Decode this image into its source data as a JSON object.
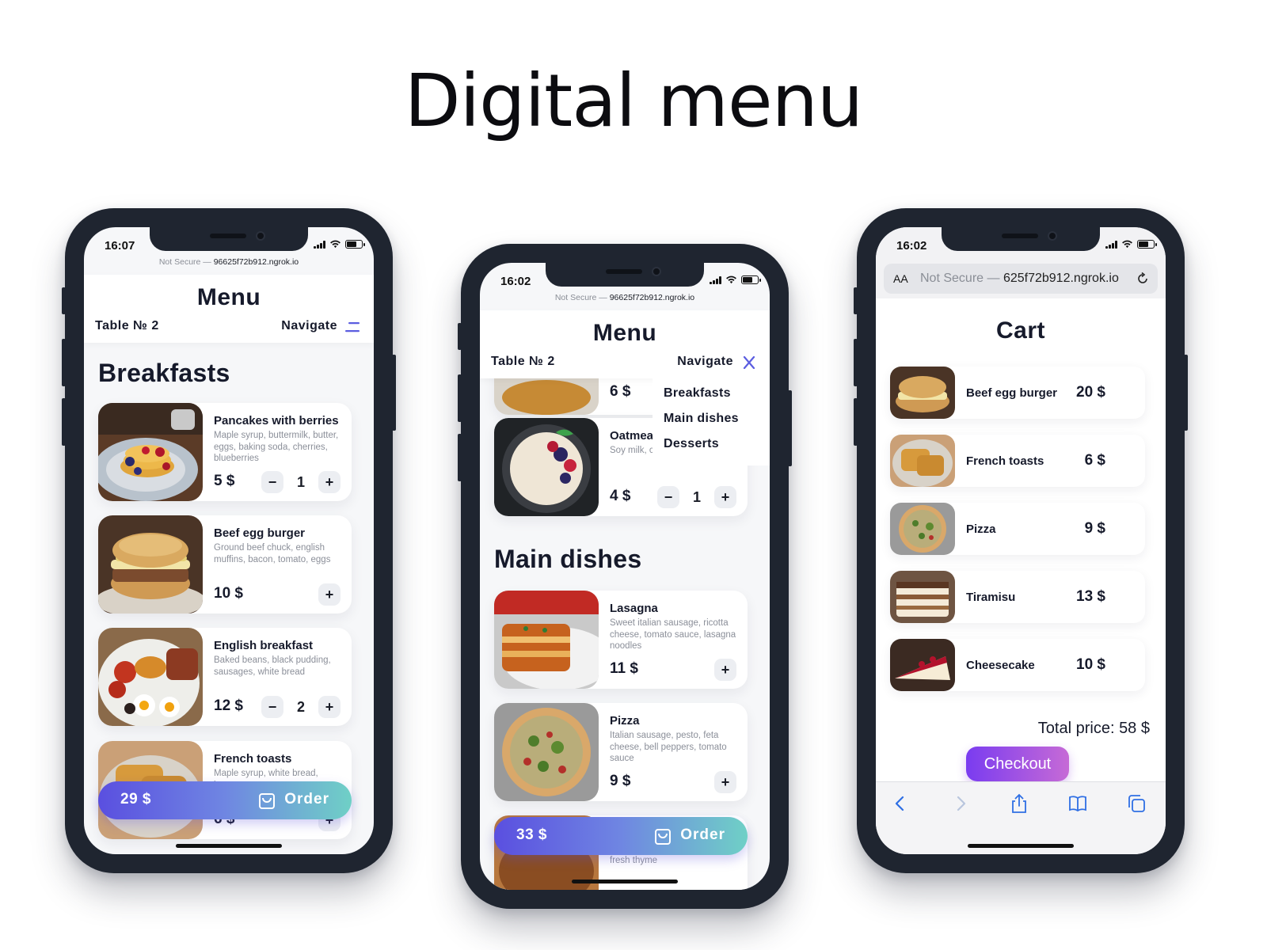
{
  "hero": {
    "title": "Digital menu"
  },
  "colors": {
    "accent_start": "#5a4fe0",
    "accent_end": "#6fd0c6",
    "checkout_start": "#7a3cf0",
    "checkout_end": "#c66ad6",
    "ios_blue": "#2f6fe4"
  },
  "phone1": {
    "time": "16:07",
    "url": {
      "prefix": "Not Secure — ",
      "host": "96625f72b912.ngrok.io"
    },
    "header": {
      "title": "Menu",
      "table": "Table № 2",
      "navigate": "Navigate",
      "nav_icon": "hamburger-icon"
    },
    "section": "Breakfasts",
    "items": [
      {
        "name": "Pancakes with berries",
        "desc": "Maple syrup, buttermilk, butter, eggs, baking soda, cherries, blueberries",
        "price": "5 $",
        "qty": "1",
        "minus": "−",
        "plus": "+"
      },
      {
        "name": "Beef egg burger",
        "desc": "Ground beef chuck, english muffins, bacon, tomato, eggs",
        "price": "10 $",
        "plus": "+"
      },
      {
        "name": "English breakfast",
        "desc": "Baked beans, black pudding, sausages, white bread",
        "price": "12 $",
        "qty": "2",
        "minus": "−",
        "plus": "+"
      },
      {
        "name": "French toasts",
        "desc": "Maple syrup, white bread, butter, eggs",
        "price": "6 $",
        "plus": "+"
      }
    ],
    "order": {
      "total": "29 $",
      "label": "Order"
    }
  },
  "phone2": {
    "time": "16:02",
    "url": {
      "prefix": "Not Secure — ",
      "host": "96625f72b912.ngrok.io"
    },
    "header": {
      "title": "Menu",
      "table": "Table № 2",
      "navigate": "Navigate",
      "nav_icon": "close-icon"
    },
    "dropdown": [
      "Breakfasts",
      "Main dishes",
      "Desserts"
    ],
    "partial_price": "6 $",
    "oatmeal": {
      "name": "Oatmeal",
      "desc": "Soy milk, cinnamon, berries",
      "price": "4 $",
      "qty": "1",
      "minus": "−",
      "plus": "+"
    },
    "section": "Main dishes",
    "items": [
      {
        "name": "Lasagna",
        "desc": "Sweet italian sausage, ricotta cheese, tomato sauce, lasagna noodles",
        "price": "11 $",
        "plus": "+"
      },
      {
        "name": "Pizza",
        "desc": "Italian sausage, pesto, feta cheese, bell peppers, tomato sauce",
        "price": "9 $",
        "plus": "+"
      }
    ],
    "peek_text": "fresh thyme",
    "order": {
      "total": "33 $",
      "label": "Order"
    }
  },
  "phone3": {
    "time": "16:02",
    "safari": {
      "aa": "AA",
      "prefix": "Not Secure — ",
      "host": "625f72b912.ngrok.io"
    },
    "title": "Cart",
    "items": [
      {
        "name": "Beef egg burger",
        "price": "20 $"
      },
      {
        "name": "French toasts",
        "price": "6 $"
      },
      {
        "name": "Pizza",
        "price": "9 $"
      },
      {
        "name": "Tiramisu",
        "price": "13 $"
      },
      {
        "name": "Cheesecake",
        "price": "10 $"
      }
    ],
    "total": "Total price: 58 $",
    "checkout": "Checkout"
  }
}
